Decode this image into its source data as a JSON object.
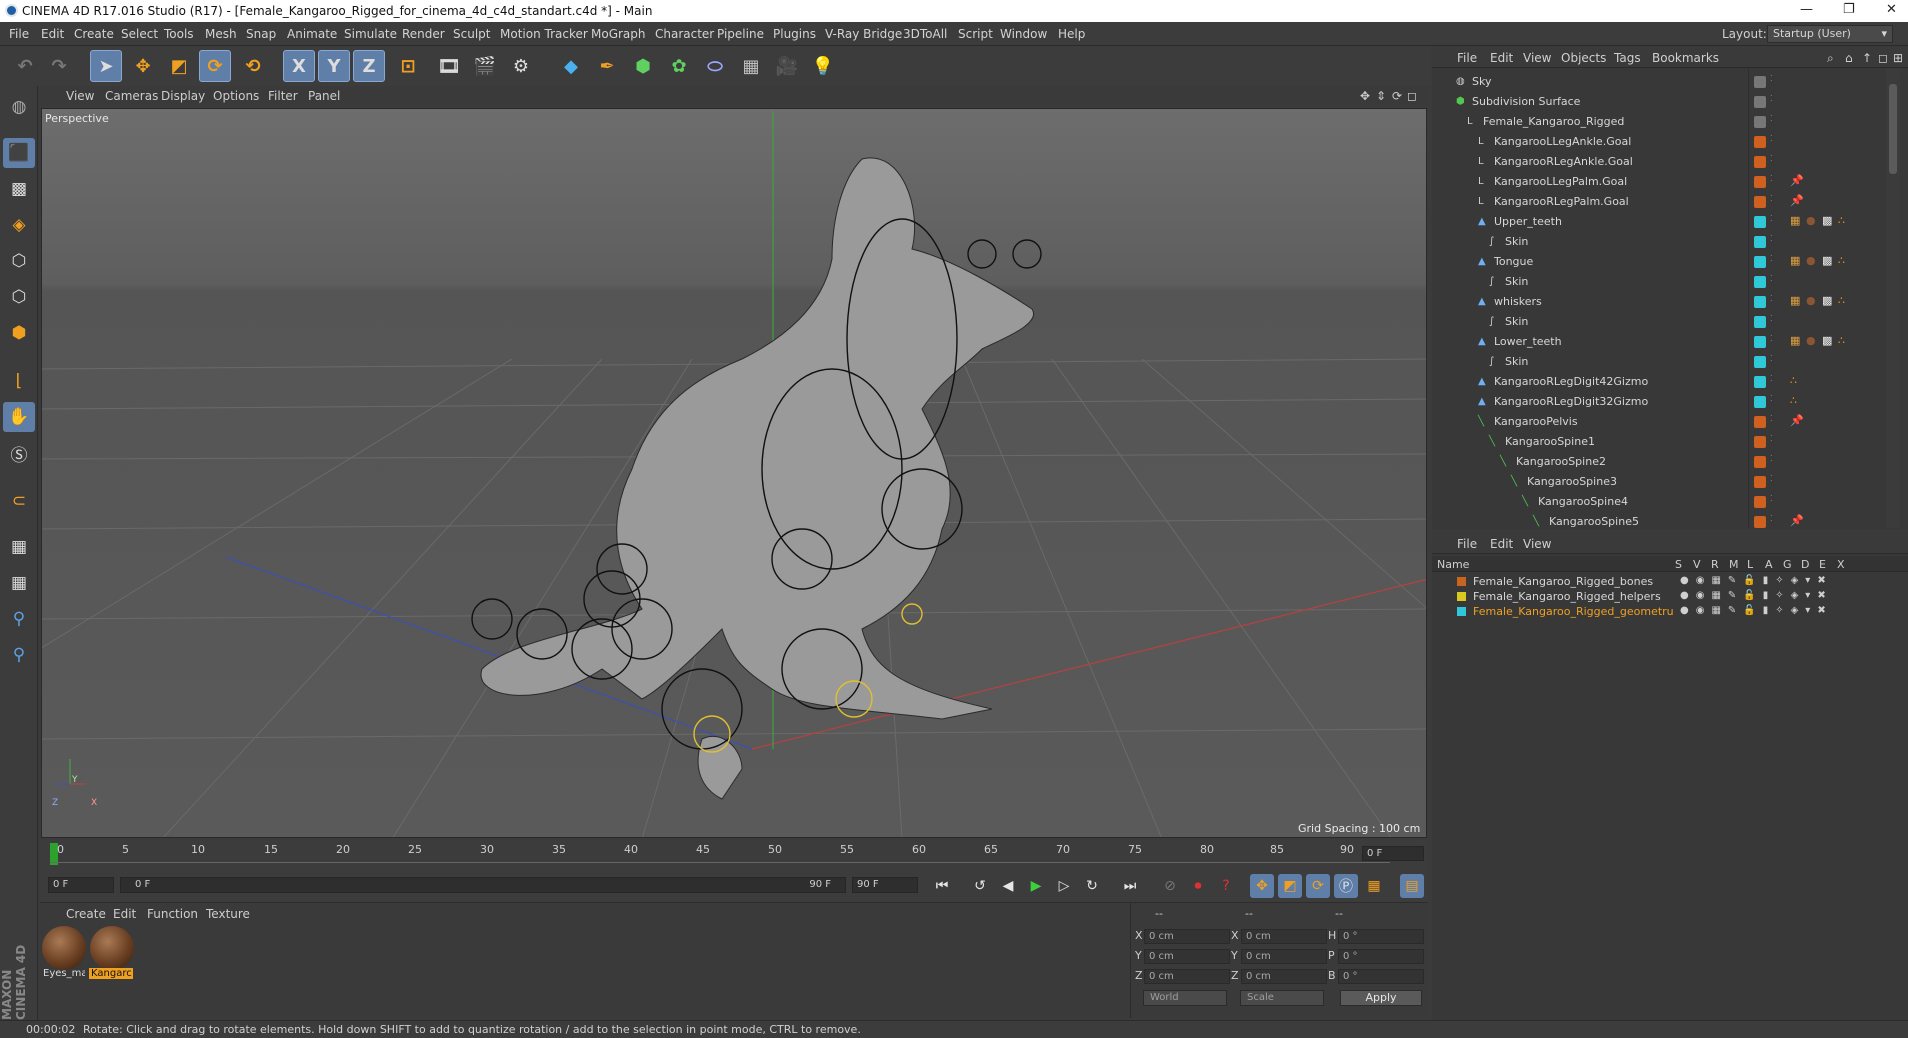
{
  "window": {
    "title": "CINEMA 4D R17.016 Studio (R17) - [Female_Kangaroo_Rigged_for_cinema_4d_c4d_standart.c4d *] - Main",
    "controls": [
      "—",
      "❐",
      "✕"
    ]
  },
  "menubar": {
    "items": [
      "File",
      "Edit",
      "Create",
      "Select",
      "Tools",
      "Mesh",
      "Snap",
      "Animate",
      "Simulate",
      "Render",
      "Sculpt",
      "Motion Tracker",
      "MoGraph",
      "Character",
      "Pipeline",
      "Plugins",
      "V-Ray Bridge",
      "3DToAll",
      "Script",
      "Window",
      "Help"
    ],
    "layout_label": "Layout:",
    "layout_value": "Startup (User)"
  },
  "toolbar": {
    "icons": [
      "undo-icon",
      "redo-icon",
      "select-arrow-icon",
      "move-icon",
      "scale-icon",
      "rotate-icon",
      "rotate-alt-icon",
      "x-axis-icon",
      "y-axis-icon",
      "z-axis-icon",
      "coordinate-system-icon",
      "render-view-icon",
      "render-region-icon",
      "render-settings-icon",
      "cube-icon",
      "pen-icon",
      "subdivision-icon",
      "cloner-icon",
      "deformer-icon",
      "floor-icon",
      "camera-icon",
      "light-icon"
    ],
    "axis_labels": [
      "X",
      "Y",
      "Z"
    ]
  },
  "viewport": {
    "menu": [
      "View",
      "Cameras",
      "Display",
      "Options",
      "Filter",
      "Panel"
    ],
    "label": "Perspective",
    "grid_spacing": "Grid Spacing : 100 cm",
    "axis_labels": [
      "Y",
      "Z",
      "X"
    ]
  },
  "timeline": {
    "ticks": [
      "0",
      "5",
      "10",
      "15",
      "20",
      "25",
      "30",
      "35",
      "40",
      "45",
      "50",
      "55",
      "60",
      "65",
      "70",
      "75",
      "80",
      "85",
      "90"
    ],
    "current_frame": "0 F",
    "start_field": "0 F",
    "range_start": "0 F",
    "range_end": "90 F",
    "end_field": "90 F"
  },
  "material_manager": {
    "menu": [
      "Create",
      "Edit",
      "Function",
      "Texture"
    ],
    "materials": [
      {
        "label": "Eyes_ma",
        "selected": false
      },
      {
        "label": "Kangarc",
        "selected": true
      }
    ]
  },
  "coordinates": {
    "header": [
      "--",
      "--",
      "--"
    ],
    "rows": [
      {
        "a": "X",
        "av": "0 cm",
        "b": "X",
        "bv": "0 cm",
        "c": "H",
        "cv": "0 °"
      },
      {
        "a": "Y",
        "av": "0 cm",
        "b": "Y",
        "bv": "0 cm",
        "c": "P",
        "cv": "0 °"
      },
      {
        "a": "Z",
        "av": "0 cm",
        "b": "Z",
        "bv": "0 cm",
        "c": "B",
        "cv": "0 °"
      }
    ],
    "mode1": "World",
    "mode2": "Scale",
    "apply": "Apply"
  },
  "object_manager": {
    "menu": [
      "File",
      "Edit",
      "View",
      "Objects",
      "Tags",
      "Bookmarks"
    ],
    "objects": [
      {
        "name": "Sky",
        "indent": 0,
        "icon": "sky-icon",
        "tag": "#777777",
        "extras": []
      },
      {
        "name": "Subdivision Surface",
        "indent": 0,
        "icon": "subdivision-icon",
        "tag": "#777777",
        "extras": []
      },
      {
        "name": "Female_Kangaroo_Rigged",
        "indent": 1,
        "icon": "null-icon",
        "tag": "#777777",
        "extras": []
      },
      {
        "name": "KangarooLLegAnkle.Goal",
        "indent": 2,
        "icon": "null-icon",
        "tag": "#d06020",
        "extras": []
      },
      {
        "name": "KangarooRLegAnkle.Goal",
        "indent": 2,
        "icon": "null-icon",
        "tag": "#d06020",
        "extras": []
      },
      {
        "name": "KangarooLLegPalm.Goal",
        "indent": 2,
        "icon": "null-icon",
        "tag": "#d06020",
        "extras": [
          "pin"
        ]
      },
      {
        "name": "KangarooRLegPalm.Goal",
        "indent": 2,
        "icon": "null-icon",
        "tag": "#d06020",
        "extras": [
          "pin"
        ]
      },
      {
        "name": "Upper_teeth",
        "indent": 2,
        "icon": "polygon-icon",
        "tag": "#30c8d8",
        "extras": [
          "check",
          "mat",
          "chk",
          "dots"
        ]
      },
      {
        "name": "Skin",
        "indent": 3,
        "icon": "skin-icon",
        "tag": "#30c8d8",
        "extras": []
      },
      {
        "name": "Tongue",
        "indent": 2,
        "icon": "polygon-icon",
        "tag": "#30c8d8",
        "extras": [
          "check",
          "mat",
          "chk",
          "dots"
        ]
      },
      {
        "name": "Skin",
        "indent": 3,
        "icon": "skin-icon",
        "tag": "#30c8d8",
        "extras": []
      },
      {
        "name": "whiskers",
        "indent": 2,
        "icon": "polygon-icon",
        "tag": "#30c8d8",
        "extras": [
          "check",
          "mat",
          "chk",
          "dots"
        ]
      },
      {
        "name": "Skin",
        "indent": 3,
        "icon": "skin-icon",
        "tag": "#30c8d8",
        "extras": []
      },
      {
        "name": "Lower_teeth",
        "indent": 2,
        "icon": "polygon-icon",
        "tag": "#30c8d8",
        "extras": [
          "check",
          "mat",
          "chk",
          "dots"
        ]
      },
      {
        "name": "Skin",
        "indent": 3,
        "icon": "skin-icon",
        "tag": "#30c8d8",
        "extras": []
      },
      {
        "name": "KangarooRLegDigit42Gizmo",
        "indent": 2,
        "icon": "polygon-icon",
        "tag": "#30c8d8",
        "extras": [
          "dots"
        ]
      },
      {
        "name": "KangarooRLegDigit32Gizmo",
        "indent": 2,
        "icon": "polygon-icon",
        "tag": "#30c8d8",
        "extras": [
          "dots"
        ]
      },
      {
        "name": "KangarooPelvis",
        "indent": 2,
        "icon": "joint-icon",
        "tag": "#d06020",
        "extras": [
          "pin"
        ]
      },
      {
        "name": "KangarooSpine1",
        "indent": 3,
        "icon": "joint-icon",
        "tag": "#d06020",
        "extras": []
      },
      {
        "name": "KangarooSpine2",
        "indent": 4,
        "icon": "joint-icon",
        "tag": "#d06020",
        "extras": []
      },
      {
        "name": "KangarooSpine3",
        "indent": 5,
        "icon": "joint-icon",
        "tag": "#d06020",
        "extras": []
      },
      {
        "name": "KangarooSpine4",
        "indent": 6,
        "icon": "joint-icon",
        "tag": "#d06020",
        "extras": []
      },
      {
        "name": "KangarooSpine5",
        "indent": 7,
        "icon": "joint-icon",
        "tag": "#d06020",
        "extras": [
          "pin"
        ]
      }
    ]
  },
  "layer_manager": {
    "menu": [
      "File",
      "Edit",
      "View"
    ],
    "columns": [
      "Name",
      "S",
      "V",
      "R",
      "M",
      "L",
      "A",
      "G",
      "D",
      "E",
      "X"
    ],
    "layers": [
      {
        "name": "Female_Kangaroo_Rigged_bones",
        "color": "#c8641e",
        "active": false
      },
      {
        "name": "Female_Kangaroo_Rigged_helpers",
        "color": "#d8c820",
        "active": false
      },
      {
        "name": "Female_Kangaroo_Rigged_geometru",
        "color": "#30c8d8",
        "active": true
      }
    ]
  },
  "statusbar": {
    "time": "00:00:02",
    "message": "Rotate: Click and drag to rotate elements. Hold down SHIFT to add to quantize rotation / add to the selection in point mode, CTRL to remove."
  },
  "branding": "MAXON CINEMA 4D"
}
